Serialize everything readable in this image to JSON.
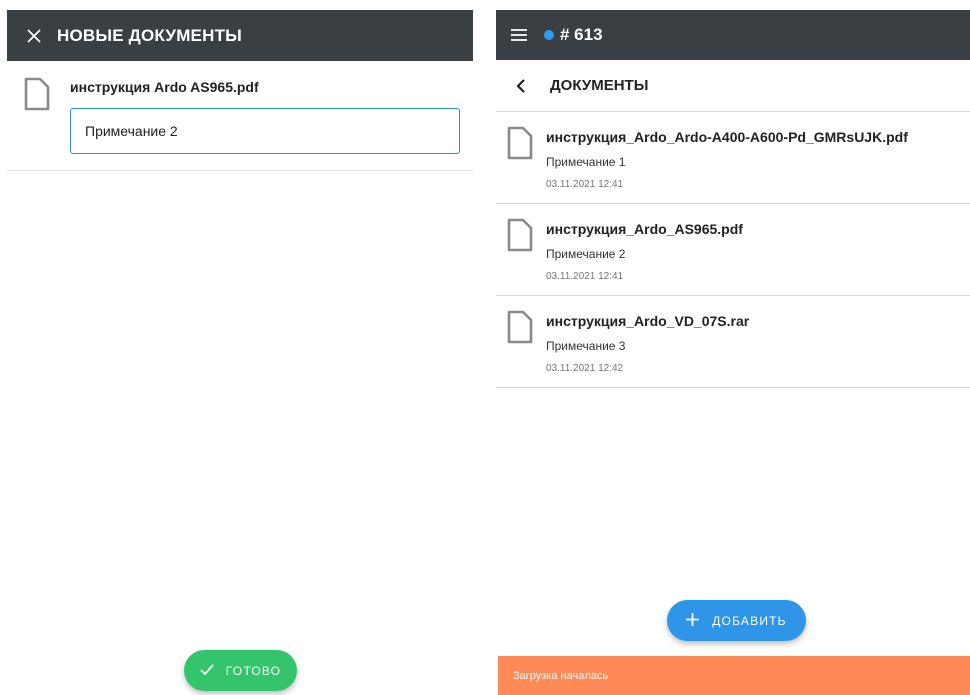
{
  "left_screen": {
    "header": {
      "title": "НОВЫЕ ДОКУМЕНТЫ",
      "close_icon": "close-icon"
    },
    "file": {
      "name": "инструкция Ardo AS965.pdf",
      "icon": "file-icon",
      "note_value": "Примечание 2"
    },
    "done_button": {
      "label": "ГОТОВО",
      "icon": "check-icon",
      "color": "#33c46c"
    }
  },
  "right_screen": {
    "header": {
      "title": "# 613",
      "menu_icon": "hamburger-menu-icon",
      "status_dot_color": "#2f9bf0"
    },
    "subheader": {
      "title": "ДОКУМЕНТЫ",
      "back_icon": "chevron-left-icon"
    },
    "documents": [
      {
        "name": "инструкция_Ardo_Ardo-A400-A600-Pd_GMRsUJK.pdf",
        "note": "Примечание 1",
        "date": "03.11.2021 12:41"
      },
      {
        "name": "инструкция_Ardo_AS965.pdf",
        "note": "Примечание 2",
        "date": "03.11.2021 12:41"
      },
      {
        "name": "инструкция_Ardo_VD_07S.rar",
        "note": "Примечание 3",
        "date": "03.11.2021 12:42"
      }
    ],
    "add_button": {
      "label": "ДОБАВИТЬ",
      "icon": "plus-icon",
      "color": "#2f95e8"
    },
    "toast": {
      "text": "Загрузка началась",
      "color": "#ff8a57"
    }
  },
  "colors": {
    "header_bg": "#3a3f44",
    "input_border": "#2b8fd6"
  }
}
